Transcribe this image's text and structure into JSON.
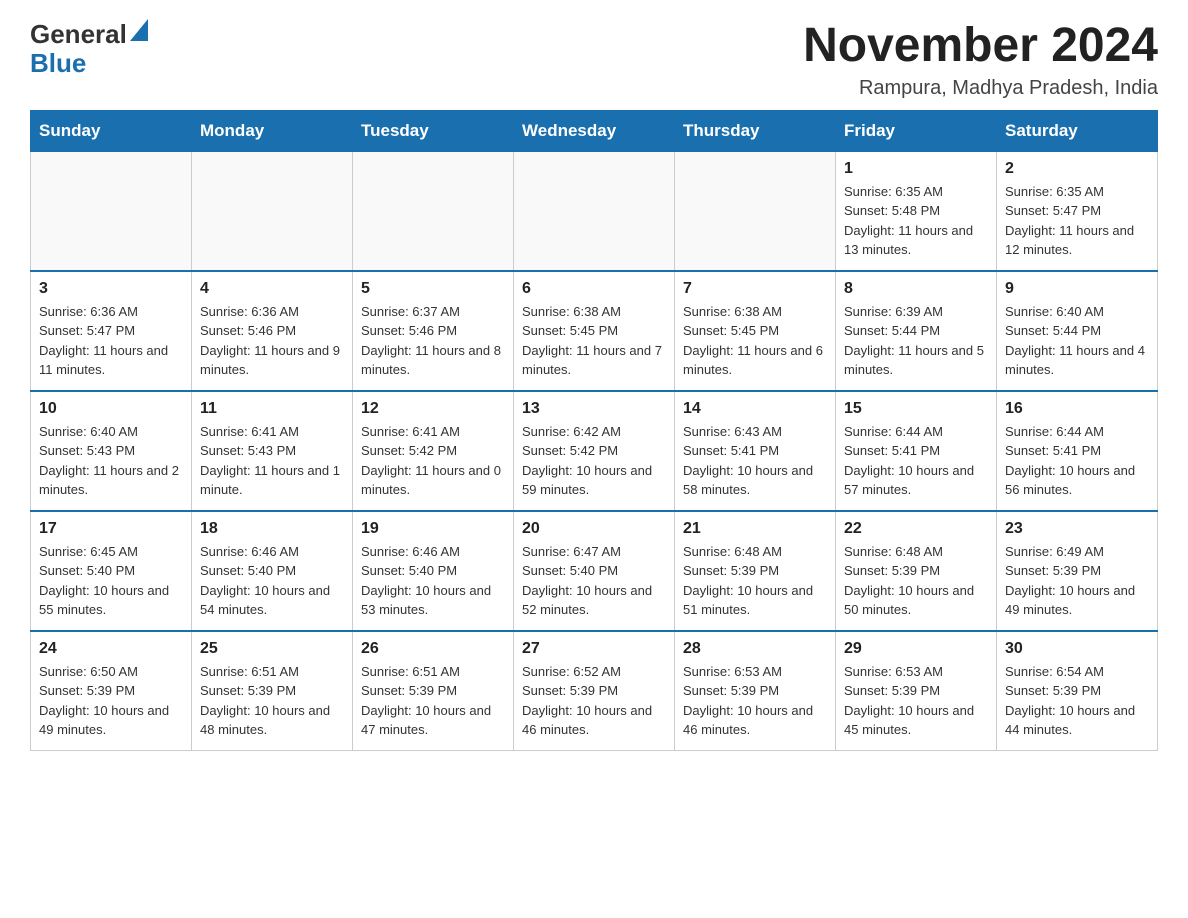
{
  "header": {
    "logo": {
      "general": "General",
      "blue": "Blue"
    },
    "title": "November 2024",
    "location": "Rampura, Madhya Pradesh, India"
  },
  "days_of_week": [
    "Sunday",
    "Monday",
    "Tuesday",
    "Wednesday",
    "Thursday",
    "Friday",
    "Saturday"
  ],
  "weeks": [
    [
      {
        "day": "",
        "info": ""
      },
      {
        "day": "",
        "info": ""
      },
      {
        "day": "",
        "info": ""
      },
      {
        "day": "",
        "info": ""
      },
      {
        "day": "",
        "info": ""
      },
      {
        "day": "1",
        "info": "Sunrise: 6:35 AM\nSunset: 5:48 PM\nDaylight: 11 hours and 13 minutes."
      },
      {
        "day": "2",
        "info": "Sunrise: 6:35 AM\nSunset: 5:47 PM\nDaylight: 11 hours and 12 minutes."
      }
    ],
    [
      {
        "day": "3",
        "info": "Sunrise: 6:36 AM\nSunset: 5:47 PM\nDaylight: 11 hours and 11 minutes."
      },
      {
        "day": "4",
        "info": "Sunrise: 6:36 AM\nSunset: 5:46 PM\nDaylight: 11 hours and 9 minutes."
      },
      {
        "day": "5",
        "info": "Sunrise: 6:37 AM\nSunset: 5:46 PM\nDaylight: 11 hours and 8 minutes."
      },
      {
        "day": "6",
        "info": "Sunrise: 6:38 AM\nSunset: 5:45 PM\nDaylight: 11 hours and 7 minutes."
      },
      {
        "day": "7",
        "info": "Sunrise: 6:38 AM\nSunset: 5:45 PM\nDaylight: 11 hours and 6 minutes."
      },
      {
        "day": "8",
        "info": "Sunrise: 6:39 AM\nSunset: 5:44 PM\nDaylight: 11 hours and 5 minutes."
      },
      {
        "day": "9",
        "info": "Sunrise: 6:40 AM\nSunset: 5:44 PM\nDaylight: 11 hours and 4 minutes."
      }
    ],
    [
      {
        "day": "10",
        "info": "Sunrise: 6:40 AM\nSunset: 5:43 PM\nDaylight: 11 hours and 2 minutes."
      },
      {
        "day": "11",
        "info": "Sunrise: 6:41 AM\nSunset: 5:43 PM\nDaylight: 11 hours and 1 minute."
      },
      {
        "day": "12",
        "info": "Sunrise: 6:41 AM\nSunset: 5:42 PM\nDaylight: 11 hours and 0 minutes."
      },
      {
        "day": "13",
        "info": "Sunrise: 6:42 AM\nSunset: 5:42 PM\nDaylight: 10 hours and 59 minutes."
      },
      {
        "day": "14",
        "info": "Sunrise: 6:43 AM\nSunset: 5:41 PM\nDaylight: 10 hours and 58 minutes."
      },
      {
        "day": "15",
        "info": "Sunrise: 6:44 AM\nSunset: 5:41 PM\nDaylight: 10 hours and 57 minutes."
      },
      {
        "day": "16",
        "info": "Sunrise: 6:44 AM\nSunset: 5:41 PM\nDaylight: 10 hours and 56 minutes."
      }
    ],
    [
      {
        "day": "17",
        "info": "Sunrise: 6:45 AM\nSunset: 5:40 PM\nDaylight: 10 hours and 55 minutes."
      },
      {
        "day": "18",
        "info": "Sunrise: 6:46 AM\nSunset: 5:40 PM\nDaylight: 10 hours and 54 minutes."
      },
      {
        "day": "19",
        "info": "Sunrise: 6:46 AM\nSunset: 5:40 PM\nDaylight: 10 hours and 53 minutes."
      },
      {
        "day": "20",
        "info": "Sunrise: 6:47 AM\nSunset: 5:40 PM\nDaylight: 10 hours and 52 minutes."
      },
      {
        "day": "21",
        "info": "Sunrise: 6:48 AM\nSunset: 5:39 PM\nDaylight: 10 hours and 51 minutes."
      },
      {
        "day": "22",
        "info": "Sunrise: 6:48 AM\nSunset: 5:39 PM\nDaylight: 10 hours and 50 minutes."
      },
      {
        "day": "23",
        "info": "Sunrise: 6:49 AM\nSunset: 5:39 PM\nDaylight: 10 hours and 49 minutes."
      }
    ],
    [
      {
        "day": "24",
        "info": "Sunrise: 6:50 AM\nSunset: 5:39 PM\nDaylight: 10 hours and 49 minutes."
      },
      {
        "day": "25",
        "info": "Sunrise: 6:51 AM\nSunset: 5:39 PM\nDaylight: 10 hours and 48 minutes."
      },
      {
        "day": "26",
        "info": "Sunrise: 6:51 AM\nSunset: 5:39 PM\nDaylight: 10 hours and 47 minutes."
      },
      {
        "day": "27",
        "info": "Sunrise: 6:52 AM\nSunset: 5:39 PM\nDaylight: 10 hours and 46 minutes."
      },
      {
        "day": "28",
        "info": "Sunrise: 6:53 AM\nSunset: 5:39 PM\nDaylight: 10 hours and 46 minutes."
      },
      {
        "day": "29",
        "info": "Sunrise: 6:53 AM\nSunset: 5:39 PM\nDaylight: 10 hours and 45 minutes."
      },
      {
        "day": "30",
        "info": "Sunrise: 6:54 AM\nSunset: 5:39 PM\nDaylight: 10 hours and 44 minutes."
      }
    ]
  ]
}
